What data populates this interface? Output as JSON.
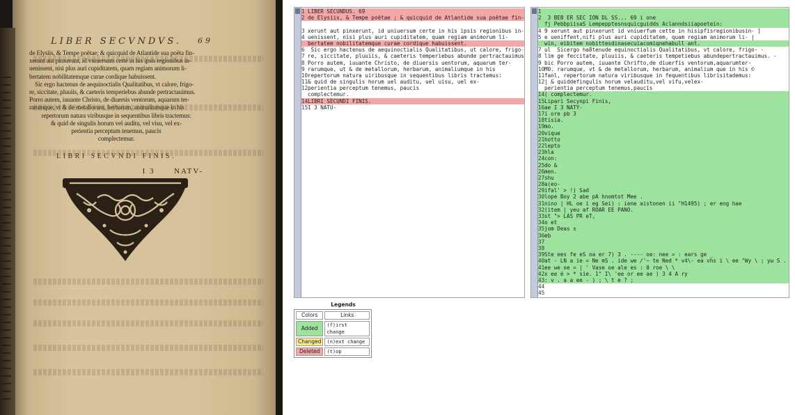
{
  "scan": {
    "running_head": "LIBER SECVNDVS.",
    "folio": "69",
    "lines": [
      "de Elysiis, & Tempe poëtae; & quicquid de Atlantide sua poëta fin-",
      "xerunt aut pinxerunt, id vniuersum certè in his ipsis regionibus in-",
      "uenissent, nisi plus auri cupiditatem, quam regiam animorum li-",
      "bertatem nobilitatemque curae cordique habuissent.",
      "Sic ergo hactenus de aequinoctialis Qualitatibus, vt calore, frigo-",
      "re, siccitate, pluuiis, & caeteris temperiebus abunde pertractauimus.",
      "Porro autem, iuuante Christo, de diuersis ventorum, aquarum ter-",
      "rarumque, vt & de metallorum, herbarum, animaliumque in his",
      "repertorum natura viribusque in sequentibus libris tractemus:",
      "& quid de singulis horum vel auditu, vel visu, vel ex-",
      "perientia perceptum tenemus, paucis",
      "complectemur."
    ],
    "finis": "LIBRI SECVNDI FINIS.",
    "catchword_sig": "I 3",
    "catchword": "NATV-"
  },
  "diff": {
    "left_lines": [
      {
        "n": "1",
        "text": "LIBER SECUNDUS. 69",
        "hl": "del"
      },
      {
        "n": "2",
        "text": "de Elysiis, & Tempe poëtae ; & quicquid de Atlantide sua poëtae fin-",
        "hl": "del"
      },
      {
        "n": "",
        "text": "",
        "hl": ""
      },
      {
        "n": "3",
        "text": "xerunt aut pinxerunt, id uniuersum certe in his ipsis regionibus in-",
        "hl": ""
      },
      {
        "n": "4",
        "text": "uenissent, nisi plus auri cupiditatem, quam regiam animorum li-",
        "hl": ""
      },
      {
        "n": "",
        "text": "bertatem nobilitatemque curae cordique habuissent.",
        "hl": "del"
      },
      {
        "n": "6",
        "text": " Sic ergo hactenus de aequinoctialis Qualitatibus, ut calore, frigo-",
        "hl": ""
      },
      {
        "n": "7",
        "text": "re, siccitate, pluuiis, & caeteris temperiebus abunde pertractauimus.",
        "hl": ""
      },
      {
        "n": "8",
        "text": "Porro autem, iuuante Christo, de diuersis uentorum, aquarum ter-",
        "hl": ""
      },
      {
        "n": "9",
        "text": "rarumque, ut & de metallorum, herbarum, animaliumque in his",
        "hl": ""
      },
      {
        "n": "10",
        "text": "repertorum natura uiribusque in sequentibus libris tractemus:",
        "hl": ""
      },
      {
        "n": "11",
        "text": "& quid de singulis horum uel auditu, uel uisu, uel ex-",
        "hl": ""
      },
      {
        "n": "12",
        "text": "perientia perceptum tenemus, paucis",
        "hl": ""
      },
      {
        "n": "",
        "text": "complectemur.",
        "hl": ""
      },
      {
        "n": "14",
        "text": "LIBRI SECUNDI FINIS.",
        "hl": "del"
      },
      {
        "n": "15",
        "text": "I 3 NATU-",
        "hl": ""
      }
    ],
    "right_lines": [
      {
        "n": "1",
        "text": "",
        "hl": "add"
      },
      {
        "n": "2",
        "text": " 3 BEB ER SEC ION DL SS... 69 i one",
        "hl": "add"
      },
      {
        "n": "",
        "text": "fj PebbpiisaS Lempepptesnsquicguidds Aclanndsiiapoetein:",
        "hl": "add"
      },
      {
        "n": "4",
        "text": "9 xerunt aut pinxerunt id vniuerfum cette in hisipfisregionibusin- ]",
        "hl": ""
      },
      {
        "n": "5",
        "text": "e ueniffent,nifi plus auri cupiditatem, quam regiam animorum li- |",
        "hl": ""
      },
      {
        "n": "",
        "text": "win, eibitem nobittesdinasecuiacomiqnehabull ant.",
        "hl": "add"
      },
      {
        "n": "7",
        "text": "ul  Sicergo ha8tenude equinoctialis Qualitatibus, vt calore, frigo- -",
        "hl": ""
      },
      {
        "n": "8",
        "text": "lim ge feccitate, pluuiis, & caeteris tempetiebus abundepertractauimus. -",
        "hl": ""
      },
      {
        "n": "9",
        "text": "bic Porro autem, iuuante Chrifto,de diuerfis ventorum,aquarumter-",
        "hl": ""
      },
      {
        "n": "10",
        "text": "M0. rarumque, vt & de metallorum, herbarum, animalium que in his ©",
        "hl": ""
      },
      {
        "n": "11",
        "text": "fanl, repertorum natura viribusque in fequentibus librisitademus:",
        "hl": ""
      },
      {
        "n": "12",
        "text": "| & quiddefingulis horum velauditu,vel vifu,velex-",
        "hl": ""
      },
      {
        "n": "",
        "text": "perientia perceptum tenemus,paucis",
        "hl": ""
      },
      {
        "n": "14",
        "text": "( complectemur.",
        "hl": "add"
      },
      {
        "n": "15",
        "text": "Lipari Secynpi Finis,",
        "hl": "add"
      },
      {
        "n": "16",
        "text": "ae I 3 NATY-",
        "hl": "add"
      },
      {
        "n": "17",
        "text": "i ore pb 3",
        "hl": "add"
      },
      {
        "n": "18",
        "text": "tisia.",
        "hl": "add"
      },
      {
        "n": "19",
        "text": "mo.",
        "hl": "add"
      },
      {
        "n": "20",
        "text": "vique",
        "hl": "add"
      },
      {
        "n": "21",
        "text": "hotto",
        "hl": "add"
      },
      {
        "n": "22",
        "text": "lepto",
        "hl": "add"
      },
      {
        "n": "23",
        "text": "hla",
        "hl": "add"
      },
      {
        "n": "24",
        "text": "con:",
        "hl": "add"
      },
      {
        "n": "25",
        "text": "do &",
        "hl": "add"
      },
      {
        "n": "26",
        "text": "men.",
        "hl": "add"
      },
      {
        "n": "27",
        "text": "shu",
        "hl": "add"
      },
      {
        "n": "28",
        "text": "a(eo-",
        "hl": "add"
      },
      {
        "n": "29",
        "text": "ifal' > !) Sad",
        "hl": "add"
      },
      {
        "n": "30",
        "text": "lope Boy 2 abe pA hnomtot Mee .",
        "hl": "add"
      },
      {
        "n": "31",
        "text": "nino | HL oe i eg Sei) : iene aistonen ii \"H1495) ; er eng hae",
        "hl": "add"
      },
      {
        "n": "32",
        "text": "(item | yeu af ROAR EE PANO.",
        "hl": "add"
      },
      {
        "n": "33",
        "text": "st \"> LAS PR eT,",
        "hl": "add"
      },
      {
        "n": "34",
        "text": "o et",
        "hl": "add"
      },
      {
        "n": "35",
        "text": "jom Deas s",
        "hl": "add"
      },
      {
        "n": "36",
        "text": "eb",
        "hl": "add"
      },
      {
        "n": "37",
        "text": "",
        "hl": "add"
      },
      {
        "n": "38",
        "text": "",
        "hl": "add"
      },
      {
        "n": "39",
        "text": "Ste ees fe eS oa er 7) 3 . ---- oe: nee = : ears ge _",
        "hl": "add"
      },
      {
        "n": "40",
        "text": "at - LN a ie = Ne mS . ide we /'~ te Ned * v4\\- ea vhs i \\ ee \"Wy \\ ; yw S .",
        "hl": "add"
      },
      {
        "n": "41",
        "text": "ee we oe = | ' Vase oe ale es : 0 roe \\ \\",
        "hl": "add"
      },
      {
        "n": "42",
        "text": "x ee é > * sie. 1\" I\\ 'ee or ee ae ) 3 4 A ry",
        "hl": "add"
      },
      {
        "n": "43",
        "text": ": v . a a ee - ) ; \\ t e ? ;",
        "hl": "add"
      },
      {
        "n": "44",
        "text": "",
        "hl": ""
      },
      {
        "n": "45",
        "text": "",
        "hl": ""
      }
    ]
  },
  "legend": {
    "title": "Legends",
    "col_colors": "Colors",
    "col_links": "Links",
    "rows": [
      {
        "label": "Added",
        "link": "(f)irst change",
        "color": "#9de29d"
      },
      {
        "label": "Changed",
        "link": "(n)ext change",
        "color": "#fbeb8d"
      },
      {
        "label": "Deleted",
        "link": "(t)op",
        "color": "#f4a7a7"
      }
    ]
  },
  "colors": {
    "added": "#9de29d",
    "changed": "#fbeb8d",
    "deleted": "#f4a7a7"
  }
}
